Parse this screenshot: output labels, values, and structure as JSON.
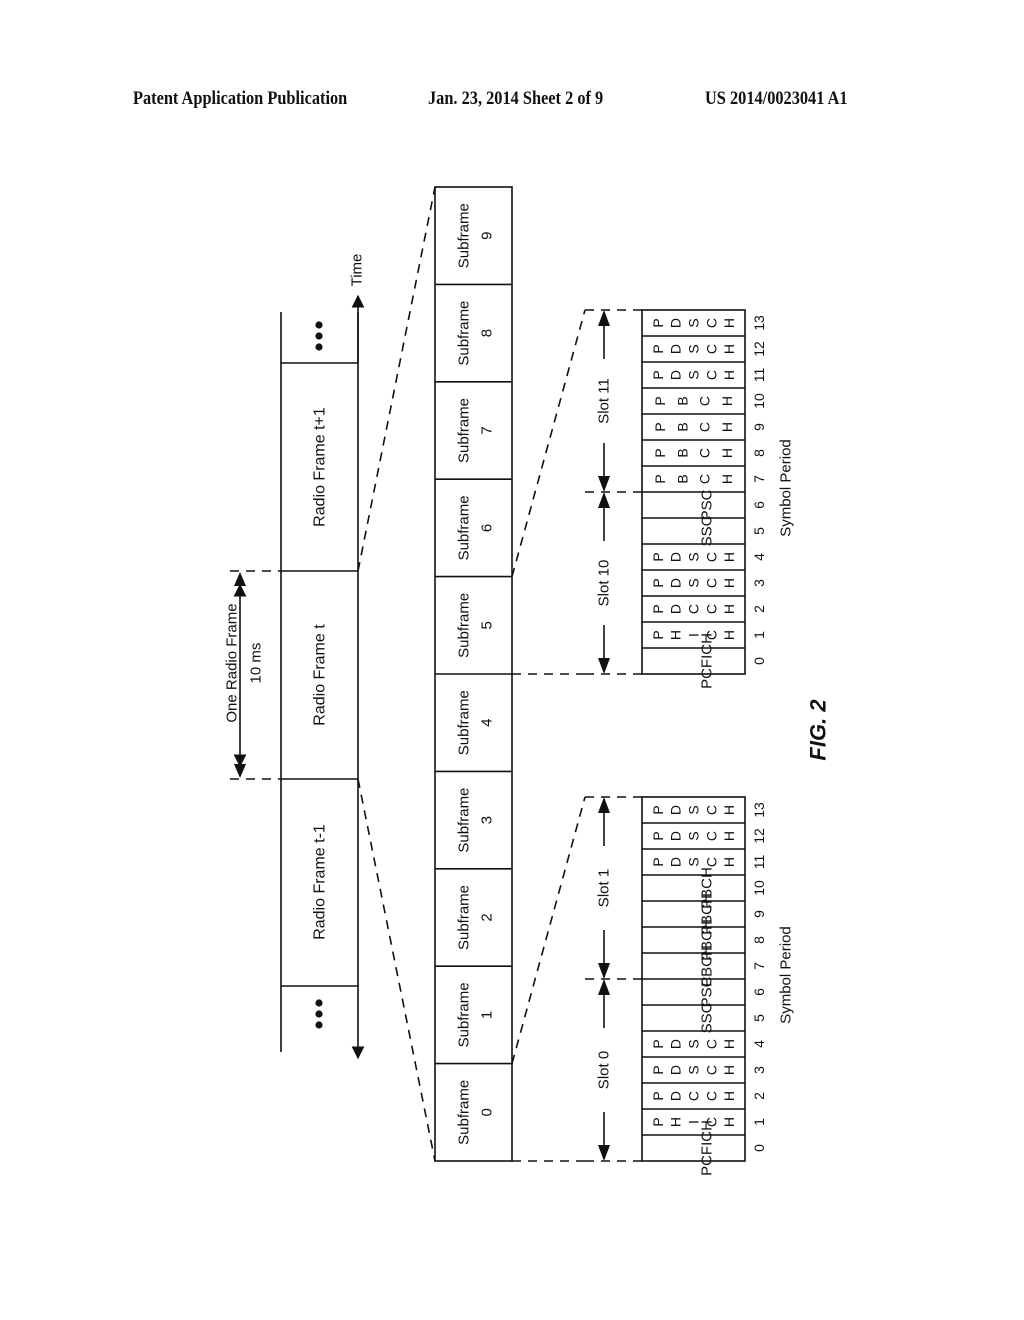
{
  "header": {
    "left": "Patent Application Publication",
    "center": "Jan. 23, 2014  Sheet 2 of 9",
    "right": "US 2014/0023041 A1"
  },
  "figure": {
    "label": "FIG. 2",
    "time_axis_label": "Time",
    "frame_span": {
      "line1": "One Radio Frame",
      "line2": "10 ms"
    },
    "radio_frames": [
      {
        "label": "Radio Frame",
        "index": "t-1"
      },
      {
        "label": "Radio Frame",
        "index": "t"
      },
      {
        "label": "Radio Frame",
        "index": "t+1"
      }
    ],
    "ellipsis": "•••",
    "subframes": [
      {
        "label": "Subframe",
        "index": "0"
      },
      {
        "label": "Subframe",
        "index": "1"
      },
      {
        "label": "Subframe",
        "index": "2"
      },
      {
        "label": "Subframe",
        "index": "3"
      },
      {
        "label": "Subframe",
        "index": "4"
      },
      {
        "label": "Subframe",
        "index": "5"
      },
      {
        "label": "Subframe",
        "index": "6"
      },
      {
        "label": "Subframe",
        "index": "7"
      },
      {
        "label": "Subframe",
        "index": "8"
      },
      {
        "label": "Subframe",
        "index": "9"
      }
    ],
    "symbol_axis_label": "Symbol Period",
    "detail_subframe0": {
      "slots": [
        "Slot 0",
        "Slot 1"
      ],
      "symbols": [
        {
          "period": "0",
          "channel": "PCFICH",
          "stacked": false
        },
        {
          "period": "1",
          "channel": "PHICH",
          "stacked": true
        },
        {
          "period": "2",
          "channel": "PDCCH",
          "stacked": true
        },
        {
          "period": "3",
          "channel": "PDSCH",
          "stacked": true
        },
        {
          "period": "4",
          "channel": "PDSCH",
          "stacked": true
        },
        {
          "period": "5",
          "channel": "SSC",
          "stacked": false
        },
        {
          "period": "6",
          "channel": "PSC",
          "stacked": false
        },
        {
          "period": "7",
          "channel": "PBCH",
          "stacked": false
        },
        {
          "period": "8",
          "channel": "PBCH",
          "stacked": false
        },
        {
          "period": "9",
          "channel": "PBCH",
          "stacked": false
        },
        {
          "period": "10",
          "channel": "PBCH",
          "stacked": false
        },
        {
          "period": "11",
          "channel": "PDSCH",
          "stacked": true
        },
        {
          "period": "12",
          "channel": "PDSCH",
          "stacked": true
        },
        {
          "period": "13",
          "channel": "PDSCH",
          "stacked": true
        }
      ]
    },
    "detail_subframe5": {
      "slots": [
        "Slot 10",
        "Slot 11"
      ],
      "symbols": [
        {
          "period": "0",
          "channel": "PCFICH",
          "stacked": false
        },
        {
          "period": "1",
          "channel": "PHICH",
          "stacked": true
        },
        {
          "period": "2",
          "channel": "PDCCH",
          "stacked": true
        },
        {
          "period": "3",
          "channel": "PDSCH",
          "stacked": true
        },
        {
          "period": "4",
          "channel": "PDSCH",
          "stacked": true
        },
        {
          "period": "5",
          "channel": "SSC",
          "stacked": false
        },
        {
          "period": "6",
          "channel": "PSC",
          "stacked": false
        },
        {
          "period": "7",
          "channel": "PBCH",
          "stacked": true
        },
        {
          "period": "8",
          "channel": "PBCH",
          "stacked": true
        },
        {
          "period": "9",
          "channel": "PBCH",
          "stacked": true
        },
        {
          "period": "10",
          "channel": "PBCH",
          "stacked": true
        },
        {
          "period": "11",
          "channel": "PDSCH",
          "stacked": true
        },
        {
          "period": "12",
          "channel": "PDSCH",
          "stacked": true
        },
        {
          "period": "13",
          "channel": "PDSCH",
          "stacked": true
        }
      ]
    }
  }
}
